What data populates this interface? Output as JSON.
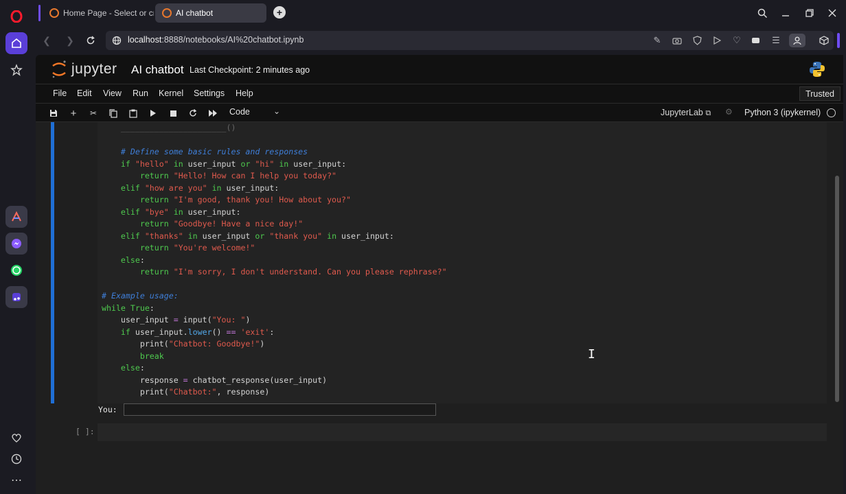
{
  "browser": {
    "tabs": [
      {
        "label": "Home Page - Select or cre",
        "active": false
      },
      {
        "label": "AI chatbot",
        "active": true
      }
    ],
    "new_tab_icon": "plus-icon",
    "address": {
      "host": "localhost",
      "rest": ":8888/notebooks/AI%20chatbot.ipynb"
    },
    "sidebar_icons": [
      "opera-logo",
      "home-icon",
      "star-icon",
      "aria-icon",
      "messenger-icon",
      "whatsapp-icon",
      "music-icon",
      "heart-icon",
      "history-icon",
      "more-icon"
    ],
    "accent": "#6f4df3"
  },
  "jupyter": {
    "wordmark": "jupyter",
    "notebook_title": "AI chatbot",
    "checkpoint": "Last Checkpoint: 2 minutes ago",
    "menu": [
      "File",
      "Edit",
      "View",
      "Run",
      "Kernel",
      "Settings",
      "Help"
    ],
    "trusted": "Trusted",
    "cell_type": "Code",
    "jupyterlab_link": "JupyterLab",
    "kernel": "Python 3 (ipykernel)",
    "stdin_prompt": "You:",
    "next_cell_prompt": "[ ]:",
    "cell_accent": "#1f6fd6"
  }
}
